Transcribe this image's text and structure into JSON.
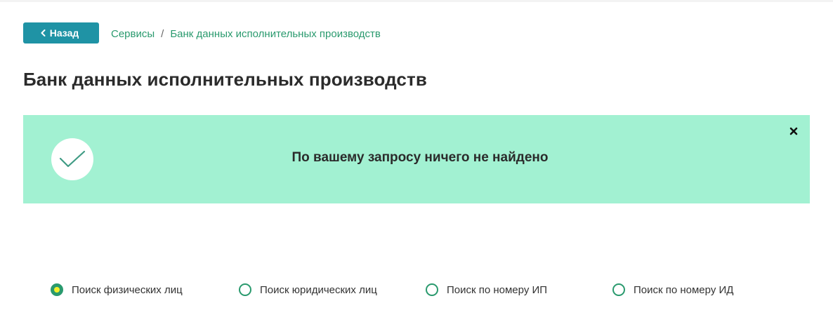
{
  "nav": {
    "back_label": "Назад",
    "breadcrumb": {
      "root": "Сервисы",
      "separator": "/",
      "current": "Банк данных исполнительных производств"
    }
  },
  "page": {
    "title": "Банк данных исполнительных производств"
  },
  "alert": {
    "message": "По вашему запросу ничего не найдено",
    "icon": "check-icon",
    "close_icon": "close-icon"
  },
  "search_modes": [
    {
      "label": "Поиск физических лиц",
      "selected": true
    },
    {
      "label": "Поиск юридических лиц",
      "selected": false
    },
    {
      "label": "Поиск по номеру ИП",
      "selected": false
    },
    {
      "label": "Поиск по номеру ИД",
      "selected": false
    }
  ],
  "colors": {
    "accent": "#1f93a5",
    "link": "#2a9a6e",
    "alert_bg": "#a2f1d2",
    "radio_dot": "#f3f02a"
  }
}
